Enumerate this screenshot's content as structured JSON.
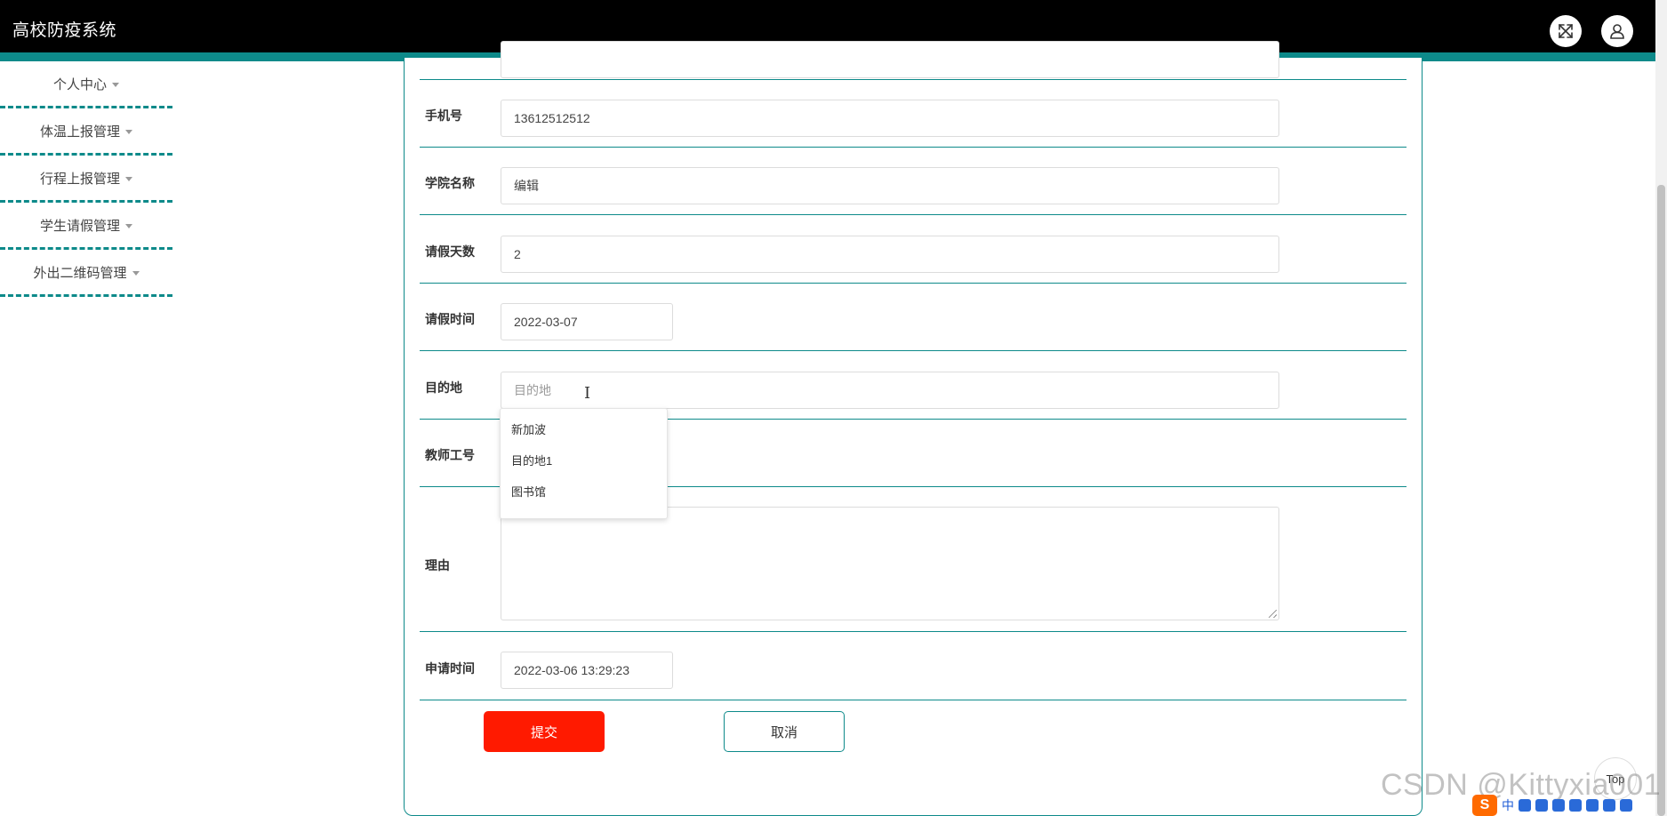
{
  "header": {
    "title": "高校防疫系统",
    "fullscreen_icon": "expand-arrows-icon",
    "user_icon": "user-icon"
  },
  "sidebar": {
    "items": [
      {
        "label": "个人中心"
      },
      {
        "label": "体温上报管理"
      },
      {
        "label": "行程上报管理"
      },
      {
        "label": "学生请假管理"
      },
      {
        "label": "外出二维码管理"
      }
    ]
  },
  "form": {
    "phone": {
      "label": "手机号",
      "value": "13612512512"
    },
    "college": {
      "label": "学院名称",
      "value": "编辑"
    },
    "leave_days": {
      "label": "请假天数",
      "value": "2"
    },
    "leave_date": {
      "label": "请假时间",
      "value": "2022-03-07"
    },
    "destination": {
      "label": "目的地",
      "placeholder": "目的地"
    },
    "teacher_id": {
      "label": "教师工号"
    },
    "reason": {
      "label": "理由"
    },
    "apply_time": {
      "label": "申请时间",
      "value": "2022-03-06 13:29:23"
    }
  },
  "destination_options": [
    "新加波",
    "目的地1",
    "图书馆"
  ],
  "buttons": {
    "submit": "提交",
    "cancel": "取消"
  },
  "to_top": "Top",
  "watermark": "CSDN @Kittyxia001",
  "ime": {
    "logo": "S",
    "mode": "中"
  },
  "colors": {
    "accent": "#0d8a8a",
    "submit": "#ff1a00",
    "header": "#000000"
  }
}
